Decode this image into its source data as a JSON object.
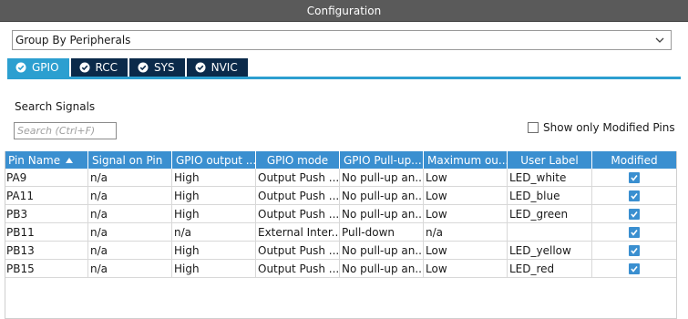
{
  "window": {
    "title": "Configuration"
  },
  "group_select": {
    "value": "Group By Peripherals"
  },
  "tabs": [
    {
      "label": "GPIO",
      "active": true
    },
    {
      "label": "RCC",
      "active": false
    },
    {
      "label": "SYS",
      "active": false
    },
    {
      "label": "NVIC",
      "active": false
    }
  ],
  "search": {
    "label": "Search Signals",
    "placeholder": "Search (Ctrl+F)"
  },
  "modified_only": {
    "label": "Show only Modified Pins",
    "checked": false
  },
  "table": {
    "columns": [
      "Pin Name",
      "Signal on Pin",
      "GPIO output ...",
      "GPIO mode",
      "GPIO Pull-up...",
      "Maximum ou...",
      "User Label",
      "Modified"
    ],
    "sort_column": "Pin Name",
    "rows": [
      {
        "pin": "PA9",
        "signal": "n/a",
        "output": "High",
        "mode": "Output Push ...",
        "pull": "No pull-up an...",
        "speed": "Low",
        "label": "LED_white",
        "modified": true
      },
      {
        "pin": "PA11",
        "signal": "n/a",
        "output": "High",
        "mode": "Output Push ...",
        "pull": "No pull-up an...",
        "speed": "Low",
        "label": "LED_blue",
        "modified": true
      },
      {
        "pin": "PB3",
        "signal": "n/a",
        "output": "High",
        "mode": "Output Push ...",
        "pull": "No pull-up an...",
        "speed": "Low",
        "label": "LED_green",
        "modified": true
      },
      {
        "pin": "PB11",
        "signal": "n/a",
        "output": "n/a",
        "mode": "External Inter...",
        "pull": "Pull-down",
        "speed": "n/a",
        "label": "",
        "modified": true
      },
      {
        "pin": "PB13",
        "signal": "n/a",
        "output": "High",
        "mode": "Output Push ...",
        "pull": "No pull-up an...",
        "speed": "Low",
        "label": "LED_yellow",
        "modified": true
      },
      {
        "pin": "PB15",
        "signal": "n/a",
        "output": "High",
        "mode": "Output Push ...",
        "pull": "No pull-up an...",
        "speed": "Low",
        "label": "LED_red",
        "modified": true
      }
    ]
  },
  "colors": {
    "titlebar": "#5a5a5a",
    "tab_active": "#2c9fd0",
    "tab_inactive": "#0b2a4a",
    "header": "#3a8fd0",
    "checkbox": "#3a8fd0"
  },
  "icons": {
    "dropdown": "chevron-down-icon",
    "tab_check": "check-circle-icon",
    "sort": "sort-ascending-icon",
    "modified": "checkbox-checked-icon"
  }
}
